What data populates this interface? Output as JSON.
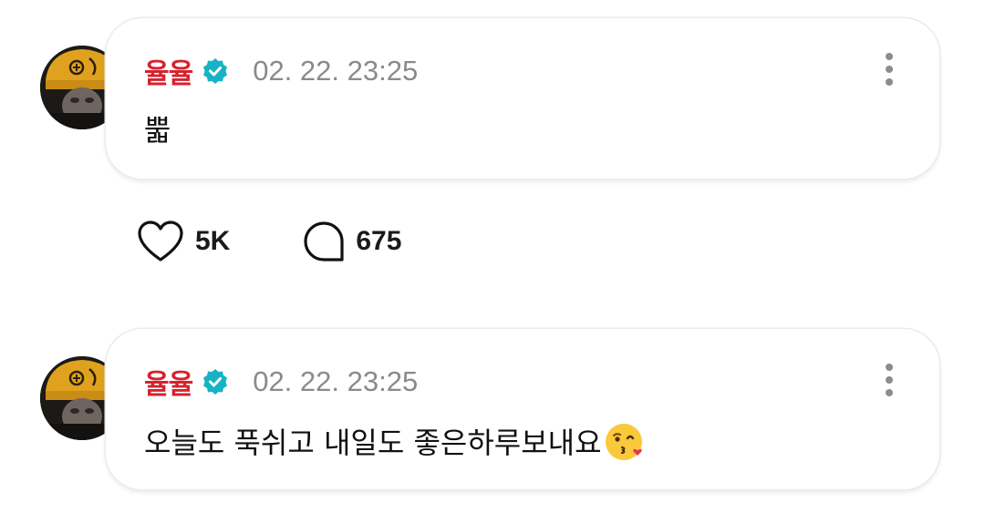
{
  "posts": [
    {
      "author": "율율",
      "verified": true,
      "timestamp": "02. 22. 23:25",
      "text": "뿗",
      "likes": "5K",
      "comments": "675"
    },
    {
      "author": "율율",
      "verified": true,
      "timestamp": "02. 22. 23:25",
      "text": "오늘도 푹쉬고 내일도 좋은하루보내요",
      "emoji": "kissing-face-with-heart-emoji"
    }
  ],
  "colors": {
    "author_name": "#d5232f",
    "verified_badge": "#17b3c4",
    "timestamp": "#8a8a8a",
    "avatar_beanie": "#e0a21e"
  },
  "icons": {
    "like": "heart-outline-icon",
    "comment": "speech-bubble-outline-icon",
    "more": "vertical-ellipsis-icon",
    "verified": "verified-badge-icon"
  }
}
